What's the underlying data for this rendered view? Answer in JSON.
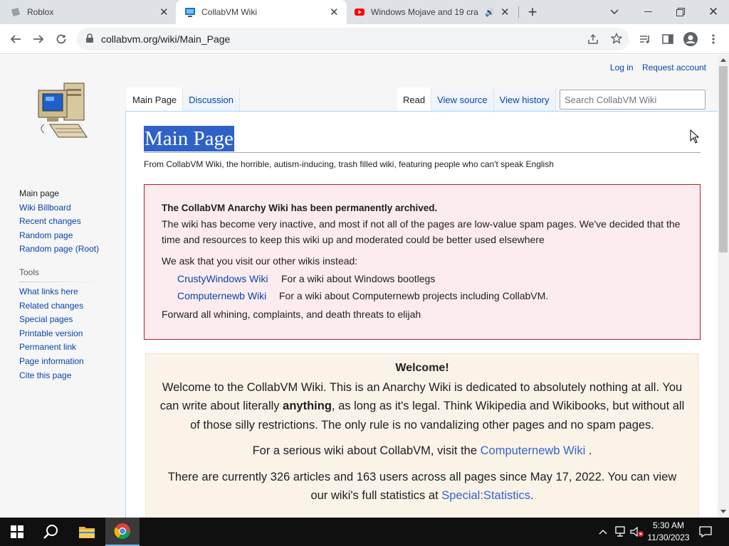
{
  "browser": {
    "tabs": [
      {
        "title": "Roblox",
        "active": false
      },
      {
        "title": "CollabVM Wiki",
        "active": true
      },
      {
        "title": "Windows Mojave and 19 cra",
        "active": false,
        "audio": true
      }
    ],
    "new_tab_icon": "plus-icon",
    "url": "collabvm.org/wiki/Main_Page"
  },
  "page": {
    "personal": {
      "login": "Log in",
      "request": "Request account"
    },
    "ns_tabs": [
      "Main Page",
      "Discussion"
    ],
    "view_tabs": [
      "Read",
      "View source",
      "View history"
    ],
    "search_placeholder": "Search CollabVM Wiki",
    "title": "Main Page",
    "tagline": "From CollabVM Wiki, the horrible, autism-inducing, trash filled wiki, featuring people who can't speak English",
    "nav": [
      "Main page",
      "Wiki Billboard",
      "Recent changes",
      "Random page",
      "Random page (Root)"
    ],
    "tools_heading": "Tools",
    "tools": [
      "What links here",
      "Related changes",
      "Special pages",
      "Printable version",
      "Permanent link",
      "Page information",
      "Cite this page"
    ],
    "notice": {
      "heading": "The CollabVM Anarchy Wiki has been permanently archived.",
      "body": "The wiki has become very inactive, and most if not all of the pages are low-value spam pages. We've decided that the time and resources to keep this wiki up and moderated could be better used elsewhere",
      "ask": "We ask that you visit our other wikis instead:",
      "wikis": [
        {
          "name": "CrustyWindows Wiki",
          "desc": "For a wiki about Windows bootlegs"
        },
        {
          "name": "Computernewb Wiki",
          "desc": "For a wiki about Computernewb projects including CollabVM."
        }
      ],
      "forward": "Forward all whining, complaints, and death threats to elijah"
    },
    "welcome": {
      "title": "Welcome!",
      "p1_a": "Welcome to the CollabVM Wiki. This is an Anarchy Wiki is dedicated to absolutely nothing at all. You can write about literally ",
      "p1_b": "anything",
      "p1_c": ", as long as it's legal. Think Wikipedia and Wikibooks, but without all of those silly restrictions. The only rule is no vandalizing other pages and no spam pages.",
      "p2_a": "For a serious wiki about CollabVM, visit the ",
      "p2_link": "Computernewb Wiki",
      "p2_b": " .",
      "p3_a": "There are currently 326 articles and 163 users across all pages since May 17, 2022. You can view our wiki's full statistics at ",
      "p3_link": "Special:Statistics",
      "p3_b": "."
    }
  },
  "taskbar": {
    "time": "5:30 AM",
    "date": "11/30/2023"
  },
  "colors": {
    "link": "#0645ad",
    "selection": "#2f62c7",
    "notice_border": "#b32424"
  }
}
